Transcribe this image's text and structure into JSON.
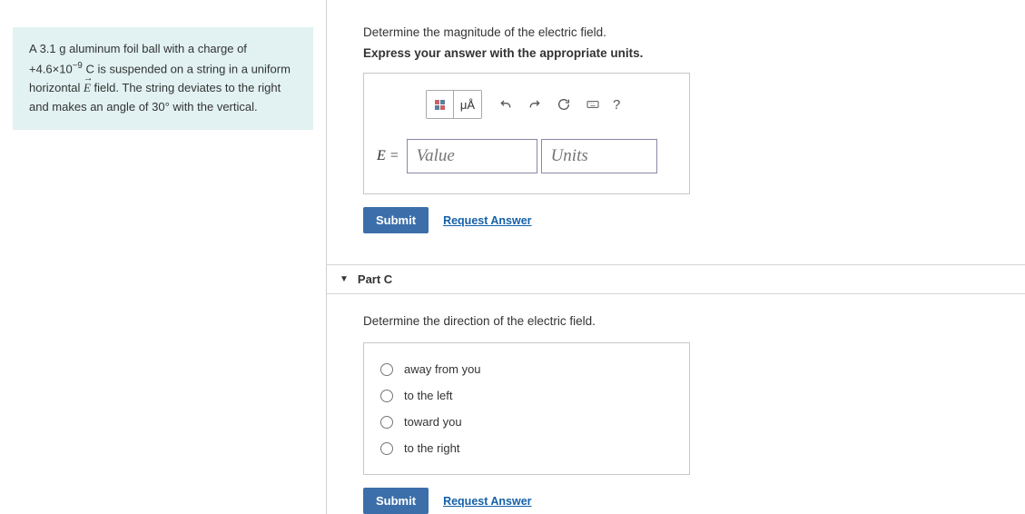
{
  "problem": {
    "text_parts": {
      "p1": "A 3.1 g aluminum foil ball with a charge of +4.6×10",
      "exp": "−9",
      "p2": " C is suspended on a string in a uniform horizontal  ",
      "vec": "E",
      "p3": " field. The string deviates to the right and makes an angle of 30° with the vertical."
    }
  },
  "partB": {
    "instr1": "Determine the magnitude of the electric field.",
    "instr2": "Express your answer with the appropriate units.",
    "toolbar": {
      "units_btn": "μÅ",
      "help": "?"
    },
    "var_label": "E =",
    "value_placeholder": "Value",
    "units_placeholder": "Units",
    "submit": "Submit",
    "request": "Request Answer"
  },
  "partC": {
    "title": "Part C",
    "instr": "Determine the direction of the electric field.",
    "options": {
      "o1": "away from you",
      "o2": "to the left",
      "o3": "toward you",
      "o4": "to the right"
    },
    "submit": "Submit",
    "request": "Request Answer"
  }
}
